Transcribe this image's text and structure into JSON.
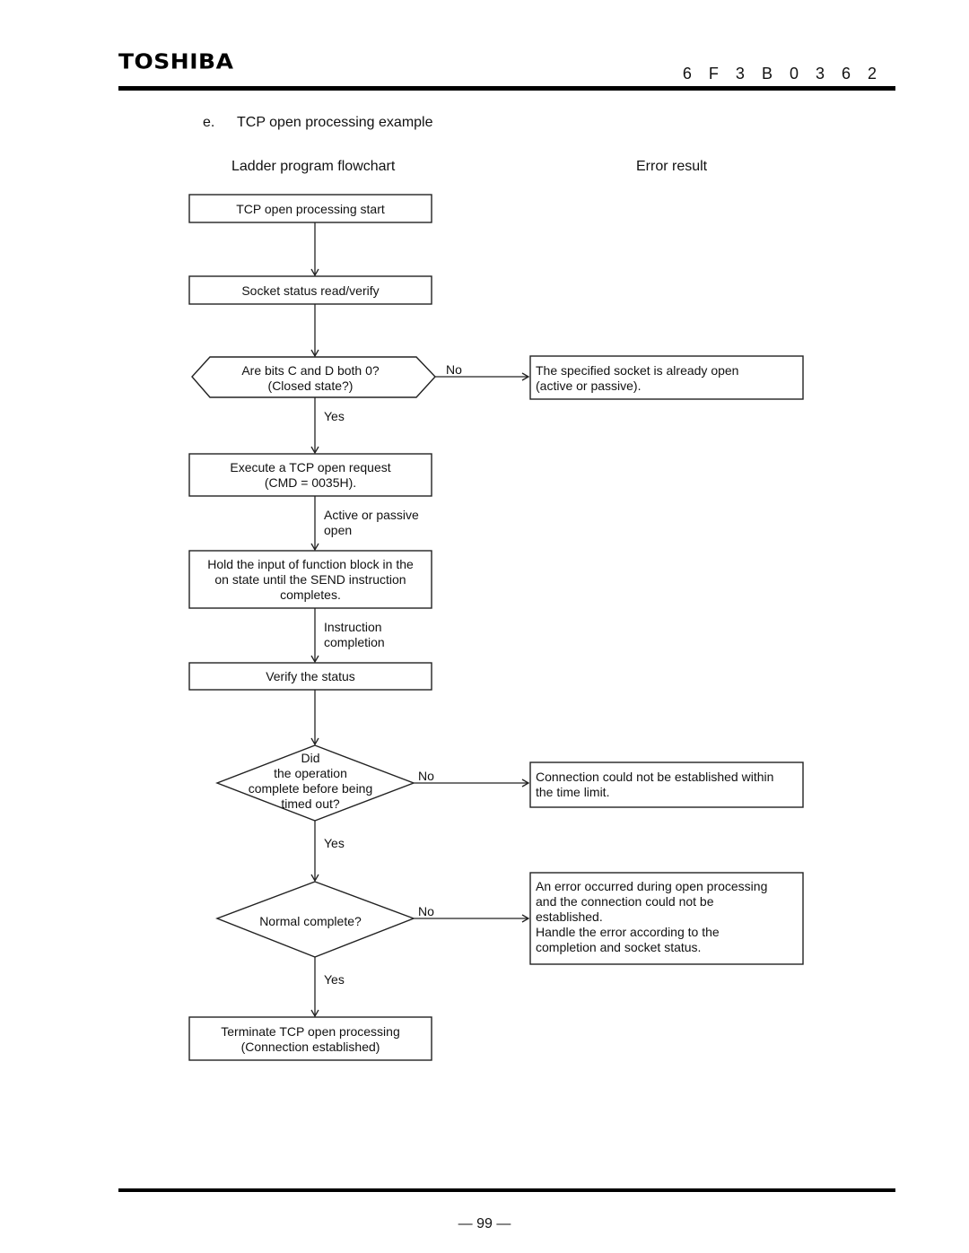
{
  "header": {
    "logo": "TOSHIBA",
    "doc_number": "6 F 3 B 0 3 6 2"
  },
  "section": {
    "letter": "e.",
    "title": "TCP open processing example"
  },
  "columns": {
    "left": "Ladder program flowchart",
    "right": "Error result"
  },
  "flow": {
    "start": [
      "TCP open processing start"
    ],
    "read": [
      "Socket status read/verify"
    ],
    "decision_closed": [
      "Are bits C and D both 0?",
      "(Closed state?)"
    ],
    "execute": [
      "Execute a TCP open request",
      "(CMD = 0035H)."
    ],
    "hold": [
      "Hold the input of function block in the",
      "on state until the SEND instruction",
      "completes."
    ],
    "verify": [
      "Verify the status"
    ],
    "decision_timeout": [
      "Did",
      "the operation",
      "complete before being",
      "timed out?"
    ],
    "decision_normal": [
      "Normal complete?"
    ],
    "end": [
      "Terminate TCP open processing",
      "(Connection established)"
    ],
    "labels": {
      "yes": "Yes",
      "no": "No",
      "active_passive": [
        "Active or passive",
        "open"
      ],
      "instruction_completion": [
        "Instruction",
        "completion"
      ]
    }
  },
  "errors": {
    "already_open": [
      "The specified socket is already open",
      "(active or passive)."
    ],
    "timeout": [
      "Connection could not be established within",
      "the time limit."
    ],
    "abnormal": [
      "An error occurred during open processing",
      "and the connection could not be",
      "established.",
      "Handle the error according to the",
      "completion and socket status."
    ]
  },
  "footer": {
    "page": "— 99 —"
  }
}
